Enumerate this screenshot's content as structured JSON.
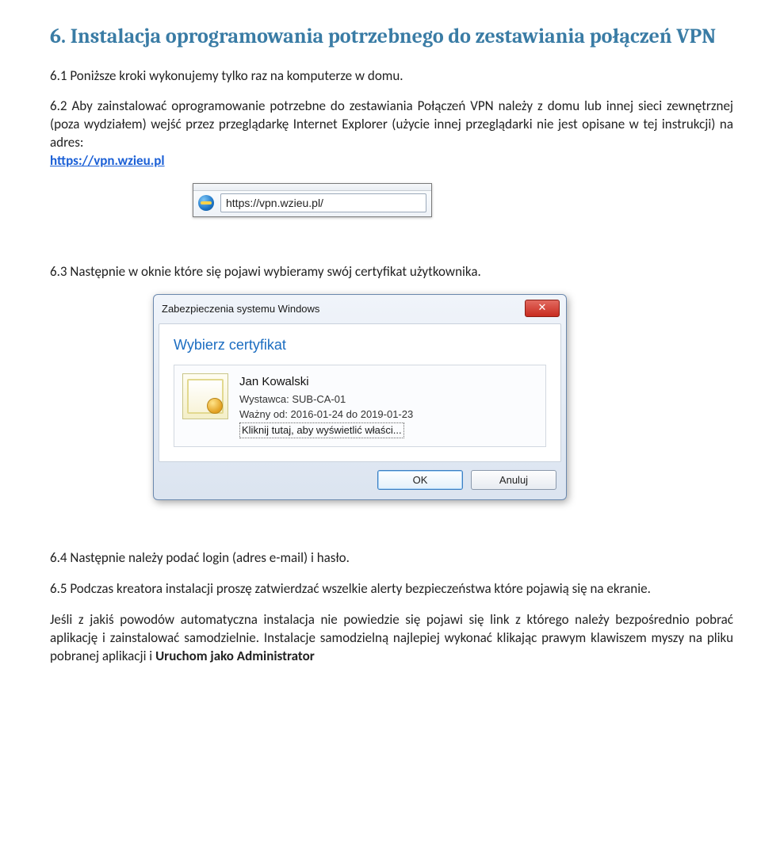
{
  "section": {
    "number": "6.",
    "title": "Instalacja oprogramowania potrzebnego do zestawiania połączeń VPN"
  },
  "p61": "6.1 Poniższe kroki wykonujemy tylko raz na komputerze w domu.",
  "p62": "6.2 Aby zainstalować oprogramowanie potrzebne do zestawiania Połączeń VPN należy z domu lub innej sieci zewnętrznej (poza wydziałem) wejść przez przeglądarkę Internet Explorer (użycie innej przeglądarki nie jest opisane w tej instrukcji) na adres:",
  "p62_link": "https://vpn.wzieu.pl",
  "addressbar": {
    "url": "https://vpn.wzieu.pl/"
  },
  "p63": "6.3 Następnie w oknie które się pojawi wybieramy swój certyfikat użytkownika.",
  "dialog": {
    "title": "Zabezpieczenia systemu Windows",
    "heading": "Wybierz certyfikat",
    "cert": {
      "name": "Jan Kowalski",
      "issuer": "Wystawca: SUB-CA-01",
      "valid": "Ważny od: 2016-01-24 do 2019-01-23",
      "details_link": "Kliknij tutaj, aby wyświetlić właści..."
    },
    "ok": "OK",
    "cancel": "Anuluj",
    "close": "✕"
  },
  "p64": "6.4 Następnie należy podać login (adres e-mail) i hasło.",
  "p65": {
    "part1": "6.5 Podczas kreatora instalacji proszę zatwierdzać wszelkie alerty bezpieczeństwa które pojawią się na ekranie.",
    "part2a": "Jeśli z jakiś powodów automatyczna instalacja nie powiedzie się pojawi się link z którego należy bezpośrednio pobrać aplikację i zainstalować samodzielnie. Instalacje samodzielną najlepiej wykonać klikając prawym klawiszem myszy na pliku pobranej aplikacji i ",
    "part2b": "Uruchom jako Administrator"
  }
}
